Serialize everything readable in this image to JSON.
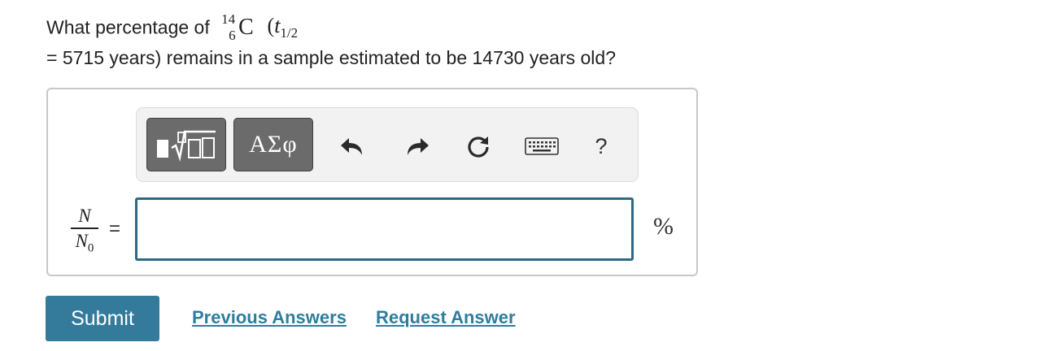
{
  "question": {
    "prefix": "What percentage of",
    "nuclide": {
      "mass_number": "14",
      "atomic_number": "6",
      "symbol": "C"
    },
    "half_life_open": "(",
    "half_life_var": "t",
    "half_life_sub": "1/2",
    "line2": "= 5715 years) remains in a sample estimated to be 14730 years old?"
  },
  "toolbar": {
    "greek_label": "ΑΣφ",
    "help_label": "?",
    "icons": [
      "templates-icon",
      "undo-icon",
      "redo-icon",
      "reset-icon",
      "keyboard-icon",
      "help-icon"
    ]
  },
  "answer": {
    "fraction_numerator": "N",
    "fraction_denominator": "N",
    "fraction_denominator_sub": "0",
    "equals": "=",
    "input_value": "",
    "unit": "%"
  },
  "actions": {
    "submit_label": "Submit",
    "previous_answers_label": "Previous Answers",
    "request_answer_label": "Request Answer"
  },
  "colors": {
    "accent": "#337a9b",
    "link": "#2e7da0",
    "input_border": "#2b6a85",
    "toolbar_button": "#6b6b6b"
  }
}
